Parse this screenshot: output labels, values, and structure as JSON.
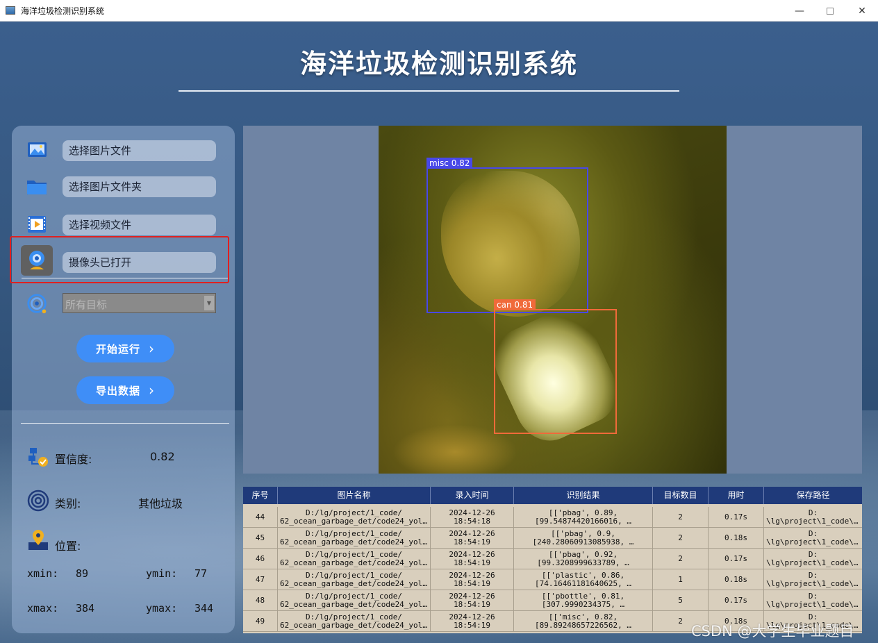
{
  "window": {
    "title": "海洋垃圾检测识别系统",
    "min": "—",
    "close": "✕"
  },
  "app": {
    "title": "海洋垃圾检测识别系统"
  },
  "sidebar": {
    "items": [
      {
        "label": "选择图片文件",
        "icon": "image-file-icon"
      },
      {
        "label": "选择图片文件夹",
        "icon": "folder-icon"
      },
      {
        "label": "选择视频文件",
        "icon": "video-file-icon"
      },
      {
        "label": "摄像头已打开",
        "icon": "camera-icon"
      }
    ],
    "target_select": {
      "value": "所有目标",
      "arrow": "▼"
    },
    "start_button": {
      "label": "开始运行",
      "chevron": "›"
    },
    "export_button": {
      "label": "导出数据",
      "chevron": "›"
    },
    "confidence": {
      "label": "置信度:",
      "value": "0.82"
    },
    "category": {
      "label": "类别:",
      "value": "其他垃圾"
    },
    "position": {
      "label": "位置:",
      "xmin_label": "xmin:",
      "xmin": "89",
      "ymin_label": "ymin:",
      "ymin": "77",
      "xmax_label": "xmax:",
      "xmax": "384",
      "ymax_label": "ymax:",
      "ymax": "344"
    }
  },
  "detections": [
    {
      "label": "misc 0.82",
      "color": "#4848e8"
    },
    {
      "label": "can 0.81",
      "color": "#f06a3a"
    }
  ],
  "table": {
    "headers": [
      "序号",
      "图片名称",
      "录入时间",
      "识别结果",
      "目标数目",
      "用时",
      "保存路径"
    ],
    "rows": [
      {
        "id": "44",
        "name1": "D:/lg/project/1_code/",
        "name2": "62_ocean_garbage_det/code24_yolov…",
        "date": "2024-12-26",
        "time": "18:54:18",
        "res1": "[['pbag', 0.89,",
        "res2": "[99.54874420166016, …",
        "count": "2",
        "elapsed": "0.17s",
        "path1": "D:",
        "path2": "\\lg\\project\\1_code\\6…"
      },
      {
        "id": "45",
        "name1": "D:/lg/project/1_code/",
        "name2": "62_ocean_garbage_det/code24_yolov…",
        "date": "2024-12-26",
        "time": "18:54:19",
        "res1": "[['pbag', 0.9,",
        "res2": "[240.28060913085938, …",
        "count": "2",
        "elapsed": "0.18s",
        "path1": "D:",
        "path2": "\\lg\\project\\1_code\\6…"
      },
      {
        "id": "46",
        "name1": "D:/lg/project/1_code/",
        "name2": "62_ocean_garbage_det/code24_yolov…",
        "date": "2024-12-26",
        "time": "18:54:19",
        "res1": "[['pbag', 0.92,",
        "res2": "[99.3208999633789, …",
        "count": "2",
        "elapsed": "0.17s",
        "path1": "D:",
        "path2": "\\lg\\project\\1_code\\6…"
      },
      {
        "id": "47",
        "name1": "D:/lg/project/1_code/",
        "name2": "62_ocean_garbage_det/code24_yolov…",
        "date": "2024-12-26",
        "time": "18:54:19",
        "res1": "[['plastic', 0.86,",
        "res2": "[74.16461181640625, …",
        "count": "1",
        "elapsed": "0.18s",
        "path1": "D:",
        "path2": "\\lg\\project\\1_code\\6…"
      },
      {
        "id": "48",
        "name1": "D:/lg/project/1_code/",
        "name2": "62_ocean_garbage_det/code24_yolov…",
        "date": "2024-12-26",
        "time": "18:54:19",
        "res1": "[['pbottle', 0.81,",
        "res2": "[307.9990234375, …",
        "count": "5",
        "elapsed": "0.17s",
        "path1": "D:",
        "path2": "\\lg\\project\\1_code\\6…"
      },
      {
        "id": "49",
        "name1": "D:/lg/project/1_code/",
        "name2": "62_ocean_garbage_det/code24_yolov…",
        "date": "2024-12-26",
        "time": "18:54:19",
        "res1": "[['misc', 0.82,",
        "res2": "[89.89248657226562, …",
        "count": "2",
        "elapsed": "0.18s",
        "path1": "D:",
        "path2": "\\lg\\project\\1_code\\6…"
      }
    ]
  },
  "watermark": "CSDN @大学生毕业题目",
  "colors": {
    "accent": "#3f8ef7",
    "table_header": "#1f3a7a",
    "highlight": "#e02020"
  }
}
